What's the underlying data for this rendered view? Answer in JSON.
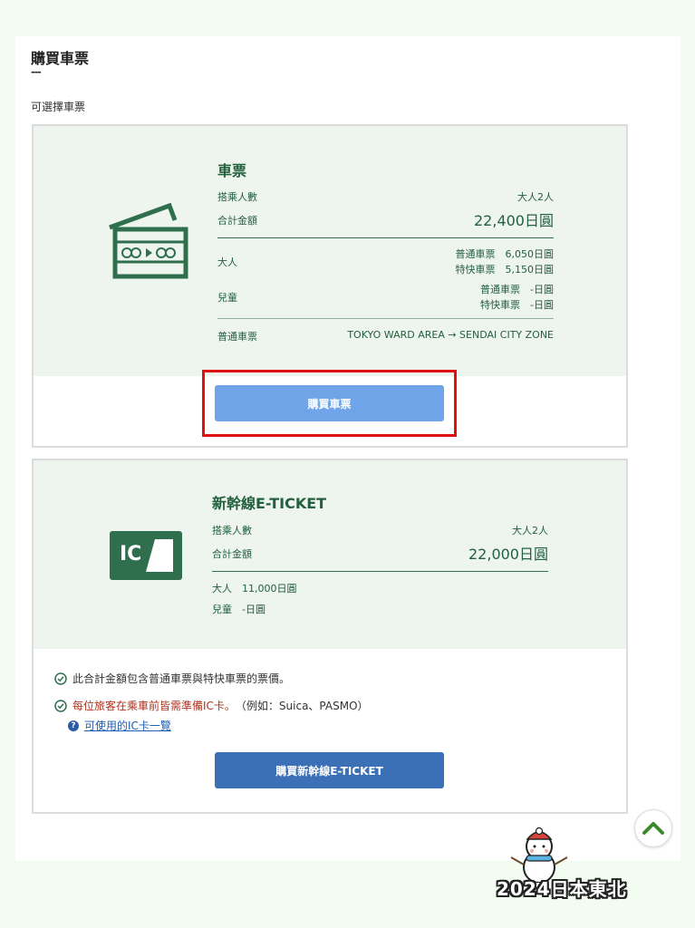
{
  "page": {
    "title": "購買車票",
    "dash": "---",
    "subtitle": "可選擇車票"
  },
  "ticket_card": {
    "title": "車票",
    "passengers_label": "搭乘人數",
    "passengers_value": "大人2人",
    "total_label": "合計金額",
    "total_value": "22,400日圓",
    "adult_label": "大人",
    "adult_lines": [
      "普通車票　6,050日圓",
      "特快車票　5,150日圓"
    ],
    "child_label": "兒童",
    "child_lines": [
      "普通車票　-日圓",
      "特快車票　-日圓"
    ],
    "route_label": "普通車票",
    "route_value": "TOKYO WARD AREA → SENDAI CITY ZONE",
    "button_label": "購買車票"
  },
  "eticket_card": {
    "title": "新幹線E-TICKET",
    "passengers_label": "搭乘人數",
    "passengers_value": "大人2人",
    "total_label": "合計金額",
    "total_value": "22,000日圓",
    "adult_line": "大人　11,000日圓",
    "child_line": "兒童　-日圓",
    "icon_text": "IC",
    "notes": {
      "note1": "此合計金額包含普通車票與特快車票的票價。",
      "note2_red": "每位旅客在乘車前皆需準備IC卡。",
      "note2_rest": "（例如：Suica、PASMO）"
    },
    "ic_link": "可使用的IC卡一覽",
    "button_label": "購買新幹線E-TICKET"
  },
  "watermark": "2024日本東北",
  "colors": {
    "green": "#23603f",
    "card_bg": "#eef4ee",
    "button_light": "#6fa5e8",
    "button_dark": "#3b6fb6",
    "highlight": "#e0110f"
  }
}
